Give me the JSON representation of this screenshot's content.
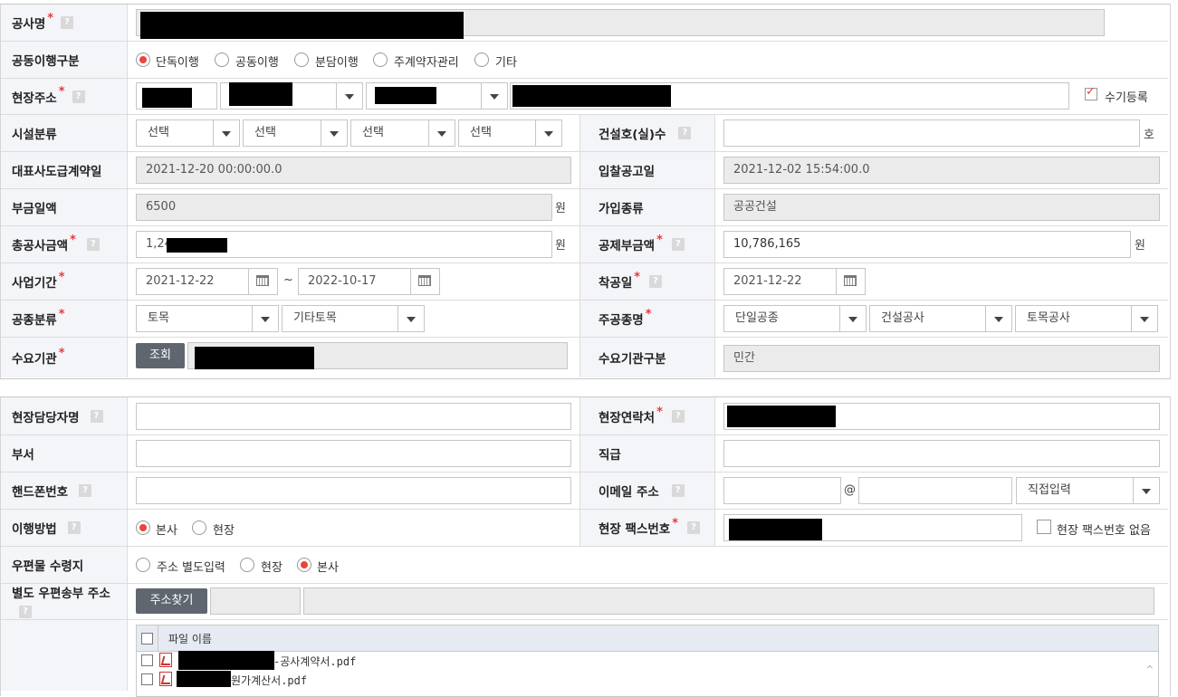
{
  "labels": {
    "project_name": "공사명",
    "joint_type": "공동이행구분",
    "site_address": "현장주소",
    "facility_class": "시설분류",
    "units": "건설호(실)수",
    "main_contract_date": "대표사도급계약일",
    "bid_date": "입찰공고일",
    "levy_amount": "부금일액",
    "join_type": "가입종류",
    "total_amount": "총공사금액",
    "deduction": "공제부금액",
    "period": "사업기간",
    "start_date": "착공일",
    "work_class": "공종분류",
    "main_work": "주공종명",
    "client": "수요기관",
    "client_type": "수요기관구분",
    "manager": "현장담당자명",
    "site_contact": "현장연락처",
    "dept": "부서",
    "rank": "직급",
    "phone": "핸드폰번호",
    "email": "이메일 주소",
    "method": "이행방법",
    "fax": "현장 팩스번호",
    "mail_recv": "우편물 수령지",
    "mail_addr": "별도 우편송부 주소"
  },
  "help_mark": "?",
  "joint_options": [
    "단독이행",
    "공동이행",
    "분담이행",
    "주계약자관리",
    "기타"
  ],
  "manual_reg": "수기등록",
  "facility_selects": [
    "선택",
    "선택",
    "선택",
    "선택"
  ],
  "units_suffix": "호",
  "main_contract_date": "2021-12-20 00:00:00.0",
  "bid_date": "2021-12-02 15:54:00.0",
  "levy_amount": "6500",
  "won": "원",
  "join_type": "공공건설",
  "total_amount_prefix": "1,24",
  "deduction": "10,786,165",
  "period_start": "2021-12-22",
  "tilde": "~",
  "period_end": "2022-10-17",
  "start_date": "2021-12-22",
  "work_class": [
    "토목",
    "기타토목"
  ],
  "main_work": [
    "단일공종",
    "건설공사",
    "토목공사"
  ],
  "lookup_btn": "조회",
  "client_type": "민간",
  "at": "@",
  "email_select": "직접입력",
  "method_options": [
    "본사",
    "현장"
  ],
  "no_fax": "현장 팩스번호 없음",
  "mail_options": [
    "주소 별도입력",
    "현장",
    "본사"
  ],
  "addr_btn": "주소찾기",
  "file_header": "파일 이름",
  "files": [
    "-공사계약서.pdf",
    "원가계산서.pdf"
  ],
  "colors": {
    "label_bg": "#f4f5f9",
    "required": "#e63b3b",
    "radio_on": "#e8453c",
    "button": "#5f6670"
  }
}
